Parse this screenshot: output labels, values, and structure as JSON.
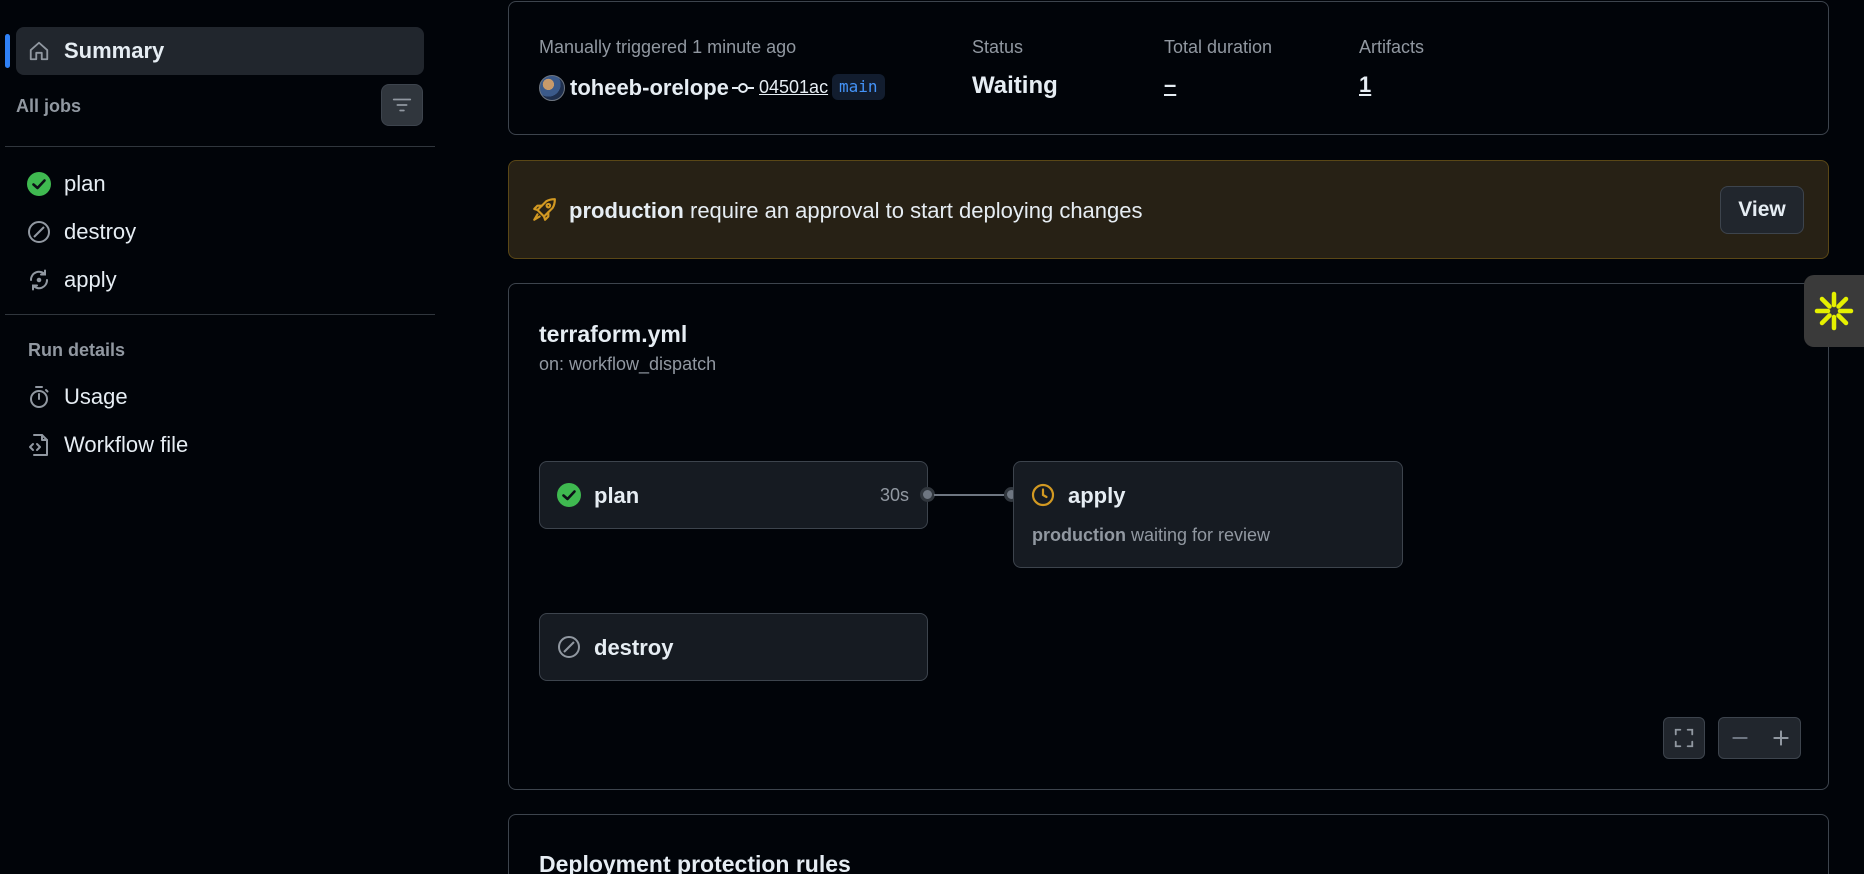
{
  "sidebar": {
    "summary_label": "Summary",
    "all_jobs_label": "All jobs",
    "jobs": [
      {
        "label": "plan",
        "status": "success"
      },
      {
        "label": "destroy",
        "status": "skipped"
      },
      {
        "label": "apply",
        "status": "waiting"
      }
    ],
    "run_details_label": "Run details",
    "details": [
      {
        "label": "Usage",
        "icon": "stopwatch-icon"
      },
      {
        "label": "Workflow file",
        "icon": "file-code-icon"
      }
    ]
  },
  "summary": {
    "trigger_text": "Manually triggered 1 minute ago",
    "user": "toheeb-orelope",
    "commit": "04501ac",
    "branch": "main",
    "status_label": "Status",
    "status_value": "Waiting",
    "duration_label": "Total duration",
    "duration_value": "–",
    "artifacts_label": "Artifacts",
    "artifacts_value": "1"
  },
  "banner": {
    "environment": "production",
    "message": " require an approval to start deploying changes",
    "view_label": "View"
  },
  "workflow": {
    "title": "terraform.yml",
    "trigger": "on: workflow_dispatch",
    "jobs": {
      "plan": {
        "name": "plan",
        "duration": "30s"
      },
      "apply": {
        "name": "apply",
        "env": "production",
        "status_text": " waiting for review"
      },
      "destroy": {
        "name": "destroy"
      }
    }
  },
  "rules": {
    "title": "Deployment protection rules"
  },
  "colors": {
    "accent": "#2f81f7",
    "success": "#3fb950",
    "waiting": "#d29922",
    "banner_bg": "#272115"
  }
}
